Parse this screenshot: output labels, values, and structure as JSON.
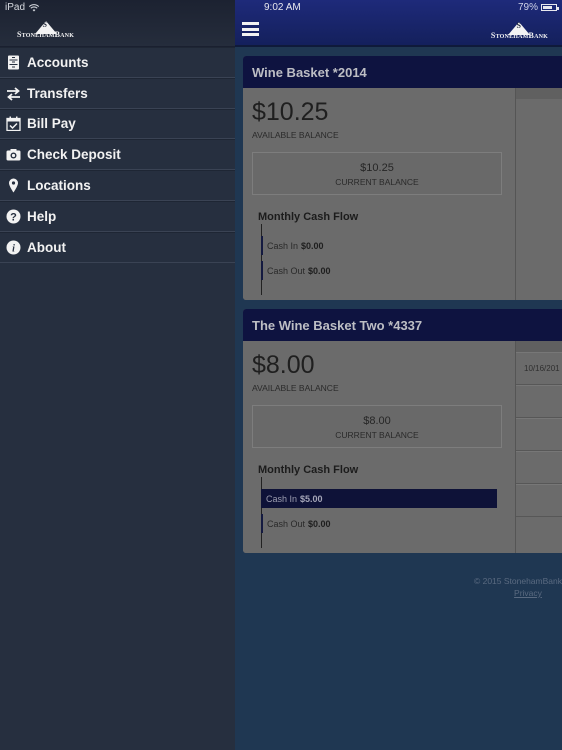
{
  "status_bar": {
    "device": "iPad",
    "time": "9:02 AM",
    "battery_percent": "79%",
    "battery_level": 0.79
  },
  "brand": {
    "name": "StonehamBank",
    "header_color": "#14205c",
    "sidebar_color": "#262f3f",
    "card_header_color": "#0e1340"
  },
  "sidebar": {
    "items": [
      {
        "label": "Accounts",
        "icon": "accounts-icon"
      },
      {
        "label": "Transfers",
        "icon": "transfers-icon"
      },
      {
        "label": "Bill Pay",
        "icon": "calendar-check-icon"
      },
      {
        "label": "Check Deposit",
        "icon": "camera-icon"
      },
      {
        "label": "Locations",
        "icon": "location-pin-icon"
      },
      {
        "label": "Help",
        "icon": "help-icon"
      },
      {
        "label": "About",
        "icon": "info-icon"
      }
    ]
  },
  "accounts": [
    {
      "name": "Wine Basket *2014",
      "available_balance": "$10.25",
      "available_label": "AVAILABLE BALANCE",
      "current_balance": "$10.25",
      "current_label": "CURRENT BALANCE",
      "cash_flow_title": "Monthly Cash Flow",
      "cash_in_label": "Cash In",
      "cash_in_value": "$0.00",
      "cash_out_label": "Cash Out",
      "cash_out_value": "$0.00",
      "transactions": []
    },
    {
      "name": "The Wine Basket Two *4337",
      "available_balance": "$8.00",
      "available_label": "AVAILABLE BALANCE",
      "current_balance": "$8.00",
      "current_label": "CURRENT BALANCE",
      "cash_flow_title": "Monthly Cash Flow",
      "cash_in_label": "Cash In",
      "cash_in_value": "$5.00",
      "cash_out_label": "Cash Out",
      "cash_out_value": "$0.00",
      "transactions": [
        "10/16/201",
        "",
        "",
        "",
        "",
        ""
      ]
    }
  ],
  "footer": {
    "copyright": "© 2015 StonehamBank",
    "privacy": "Privacy"
  }
}
